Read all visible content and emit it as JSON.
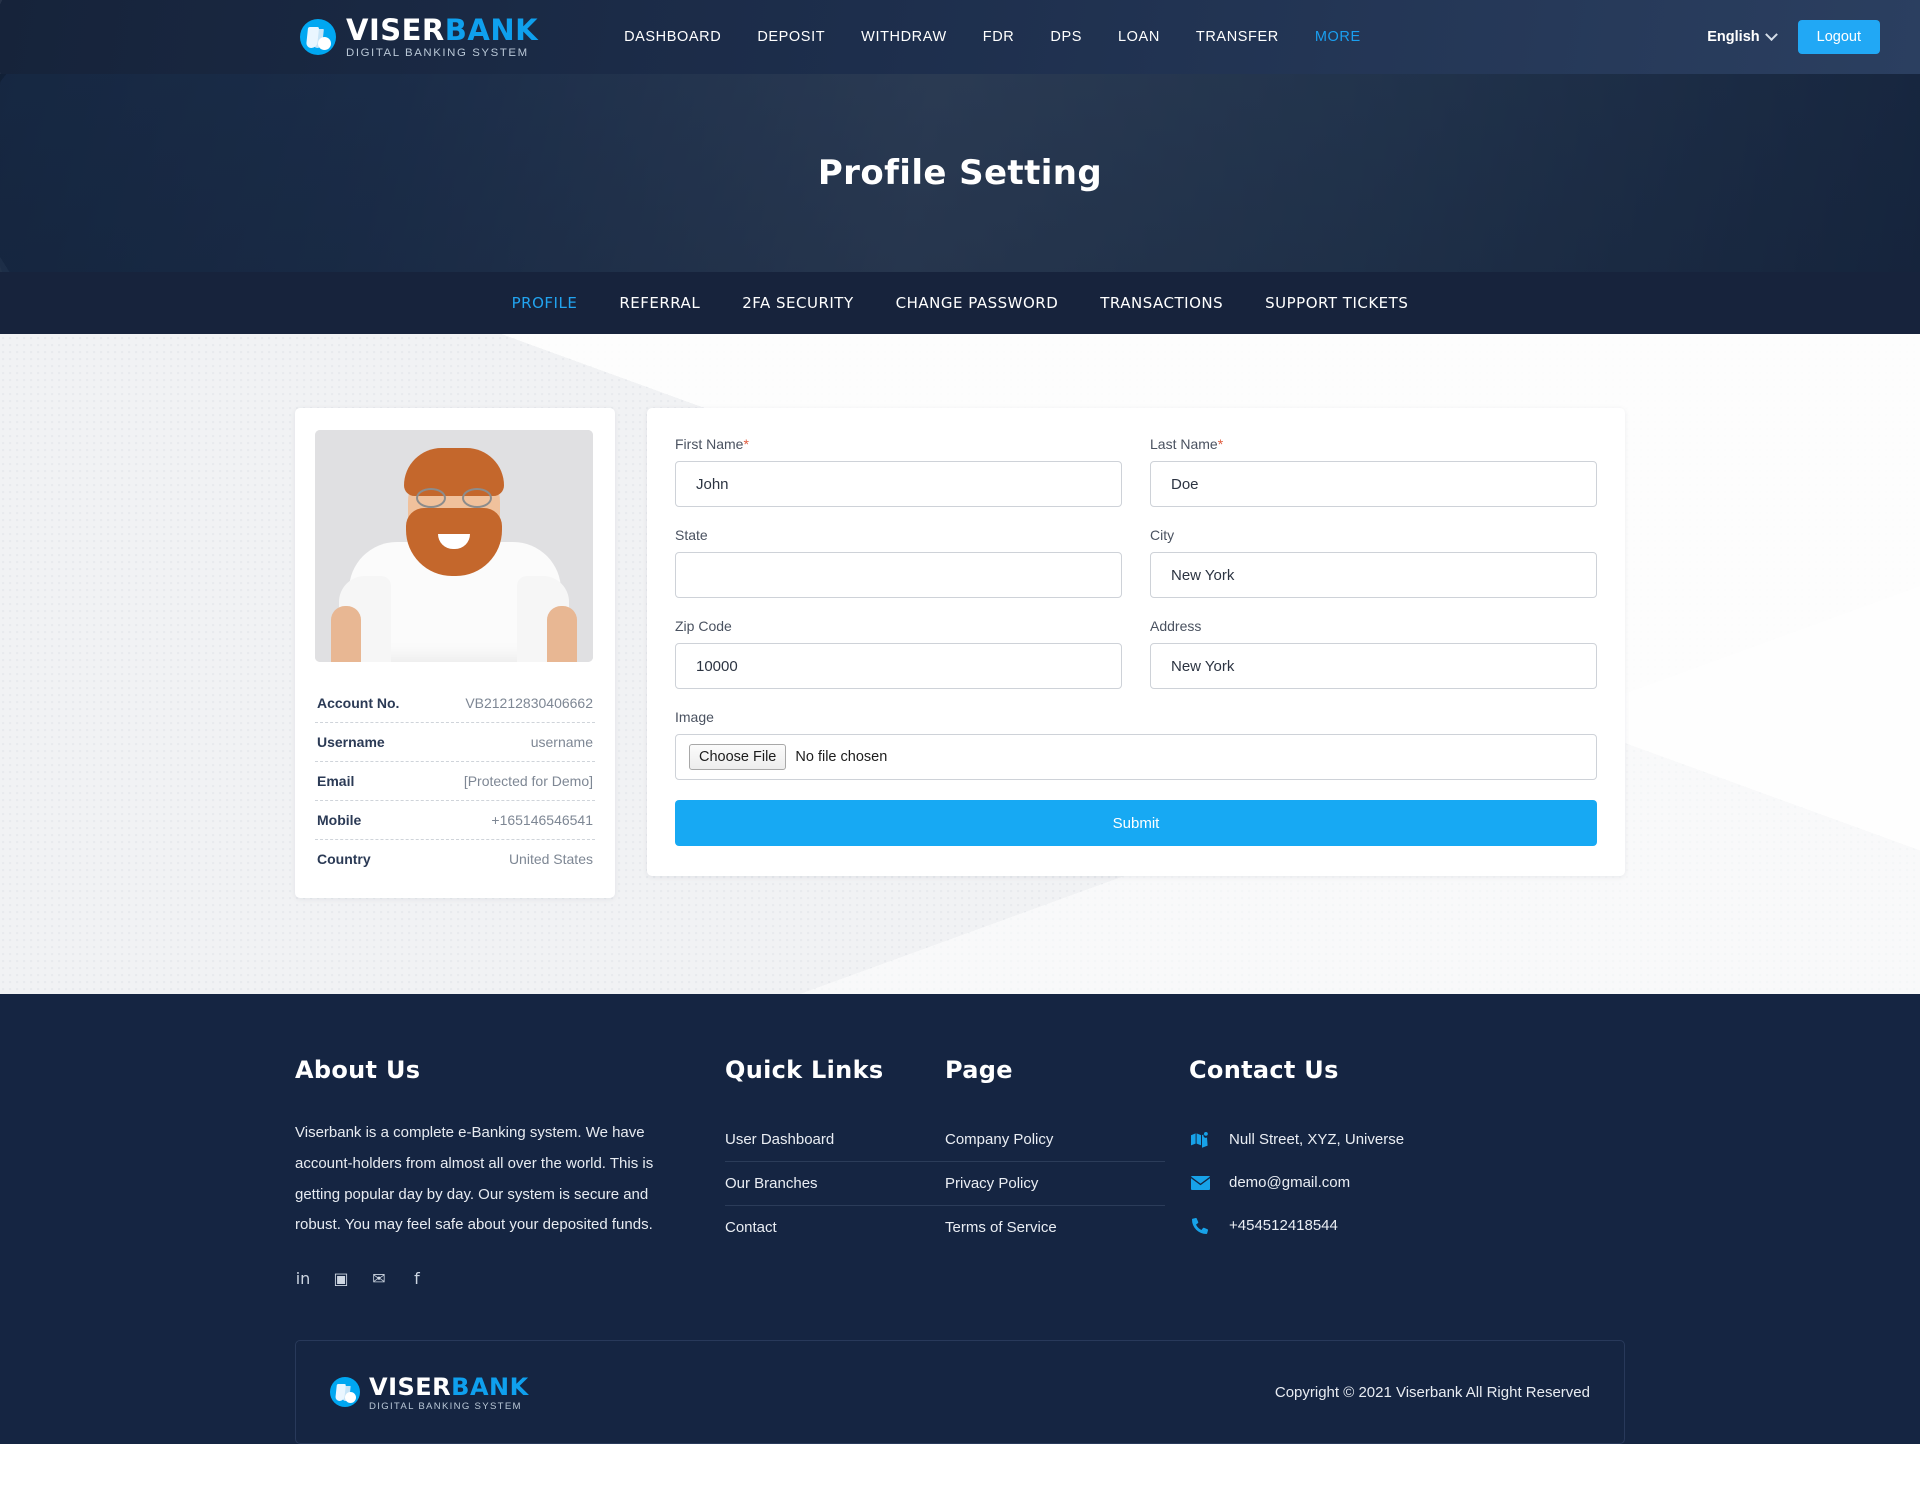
{
  "header": {
    "brand": {
      "word1": "VISER",
      "word2": "BANK",
      "tagline": "DIGITAL BANKING SYSTEM"
    },
    "nav": [
      {
        "label": "DASHBOARD",
        "accent": false
      },
      {
        "label": "DEPOSIT",
        "accent": false
      },
      {
        "label": "WITHDRAW",
        "accent": false
      },
      {
        "label": "FDR",
        "accent": false
      },
      {
        "label": "DPS",
        "accent": false
      },
      {
        "label": "LOAN",
        "accent": false
      },
      {
        "label": "TRANSFER",
        "accent": false
      },
      {
        "label": "MORE",
        "accent": true
      }
    ],
    "language": "English",
    "logout_label": "Logout"
  },
  "hero": {
    "title": "Profile Setting"
  },
  "tabs": [
    {
      "label": "PROFILE",
      "active": true
    },
    {
      "label": "REFERRAL",
      "active": false
    },
    {
      "label": "2FA SECURITY",
      "active": false
    },
    {
      "label": "CHANGE PASSWORD",
      "active": false
    },
    {
      "label": "TRANSACTIONS",
      "active": false
    },
    {
      "label": "SUPPORT TICKETS",
      "active": false
    }
  ],
  "profile_card": {
    "details": [
      {
        "key": "Account No.",
        "value": "VB21212830406662"
      },
      {
        "key": "Username",
        "value": "username"
      },
      {
        "key": "Email",
        "value": "[Protected for Demo]"
      },
      {
        "key": "Mobile",
        "value": "+165146546541"
      },
      {
        "key": "Country",
        "value": "United States"
      }
    ]
  },
  "form": {
    "fields": [
      {
        "label": "First Name",
        "required": true,
        "value": "John"
      },
      {
        "label": "Last Name",
        "required": true,
        "value": "Doe"
      },
      {
        "label": "State",
        "required": false,
        "value": ""
      },
      {
        "label": "City",
        "required": false,
        "value": "New York"
      },
      {
        "label": "Zip Code",
        "required": false,
        "value": "10000"
      },
      {
        "label": "Address",
        "required": false,
        "value": "New York"
      }
    ],
    "image_label": "Image",
    "choose_file_label": "Choose File",
    "no_file_label": "No file chosen",
    "submit_label": "Submit"
  },
  "footer": {
    "about": {
      "heading": "About Us",
      "text": "Viserbank is a complete e-Banking system. We have account-holders from almost all over the world. This is getting popular day by day. Our system is secure and robust. You may feel safe about your deposited funds.",
      "socials": [
        {
          "name": "linkedin-icon",
          "glyph": "in"
        },
        {
          "name": "instagram-icon",
          "glyph": "▣"
        },
        {
          "name": "twitter-icon",
          "glyph": "✉"
        },
        {
          "name": "facebook-icon",
          "glyph": "f"
        }
      ]
    },
    "quick_links": {
      "heading": "Quick Links",
      "items": [
        "User Dashboard",
        "Our Branches",
        "Contact"
      ]
    },
    "page": {
      "heading": "Page",
      "items": [
        "Company Policy",
        "Privacy Policy",
        "Terms of Service"
      ]
    },
    "contact": {
      "heading": "Contact Us",
      "items": [
        {
          "icon": "map-icon",
          "text": "Null Street, XYZ, Universe"
        },
        {
          "icon": "email-icon",
          "text": "demo@gmail.com"
        },
        {
          "icon": "phone-icon",
          "text": "+454512418544"
        }
      ]
    },
    "copyright": "Copyright © 2021 Viserbank All Right Reserved"
  },
  "colors": {
    "accent": "#17a9f3",
    "header_bg": "#1b2a44",
    "tabbar_bg": "#17233c",
    "footer_bg": "#152542",
    "required": "#e05c3e"
  }
}
